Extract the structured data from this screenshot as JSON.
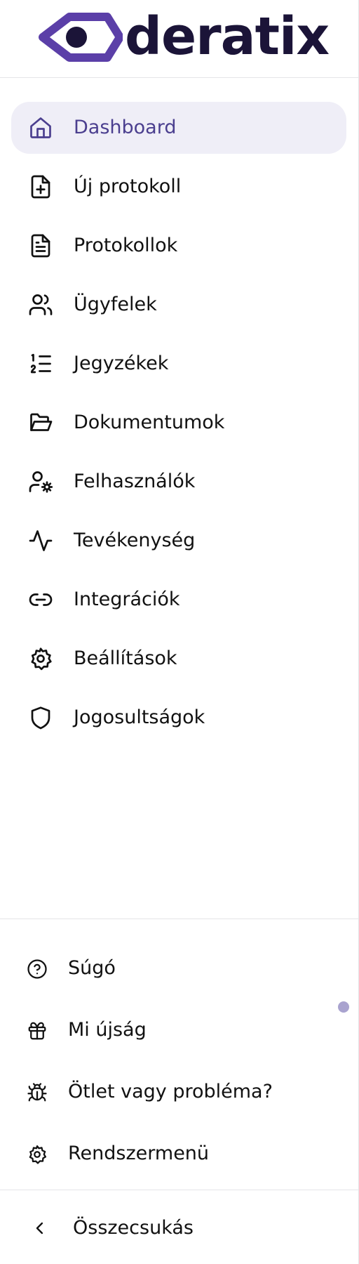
{
  "brand": {
    "logo_text": "deratix",
    "colors": {
      "mark": "#5b3fa8",
      "text": "#1b1438"
    }
  },
  "nav": {
    "active_color": "#4b3f8f",
    "active_bg": "#efeef7",
    "items": [
      {
        "label": "Dashboard",
        "icon": "home-icon",
        "active": true
      },
      {
        "label": "Új protokoll",
        "icon": "file-plus-icon"
      },
      {
        "label": "Protokollok",
        "icon": "file-text-icon"
      },
      {
        "label": "Ügyfelek",
        "icon": "users-icon"
      },
      {
        "label": "Jegyzékek",
        "icon": "list-ordered-icon"
      },
      {
        "label": "Dokumentumok",
        "icon": "folder-open-icon"
      },
      {
        "label": "Felhasználók",
        "icon": "user-cog-icon"
      },
      {
        "label": "Tevékenység",
        "icon": "activity-icon"
      },
      {
        "label": "Integrációk",
        "icon": "link-icon"
      },
      {
        "label": "Beállítások",
        "icon": "settings-icon"
      },
      {
        "label": "Jogosultságok",
        "icon": "shield-icon"
      }
    ]
  },
  "utility": {
    "items": [
      {
        "label": "Súgó",
        "icon": "help-circle-icon"
      },
      {
        "label": "Mi újság",
        "icon": "gift-icon"
      },
      {
        "label": "Ötlet vagy probléma?",
        "icon": "bug-icon"
      },
      {
        "label": "Rendszermenü",
        "icon": "settings-icon"
      }
    ]
  },
  "footer": {
    "collapse_label": "Összecsukás",
    "collapse_icon": "chevron-left-icon"
  }
}
